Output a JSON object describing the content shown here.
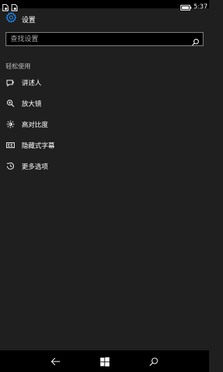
{
  "status_bar": {
    "time": "5:37",
    "left_icons": [
      "notification-doc-icon",
      "notification-doc-icon"
    ],
    "right_icons": [
      "battery-icon"
    ]
  },
  "header": {
    "icon": "gear-icon",
    "title": "设置"
  },
  "search": {
    "placeholder": "查找设置",
    "icon": "search-icon"
  },
  "section": {
    "title": "轻松使用"
  },
  "menu": {
    "items": [
      {
        "label": "讲述人",
        "icon": "narrator-icon"
      },
      {
        "label": "放大镜",
        "icon": "magnifier-icon"
      },
      {
        "label": "高对比度",
        "icon": "high-contrast-icon"
      },
      {
        "label": "隐藏式字幕",
        "icon": "closed-captions-icon"
      },
      {
        "label": "更多选项",
        "icon": "more-options-icon"
      }
    ]
  },
  "nav_bar": {
    "buttons": [
      "back-icon",
      "windows-start-icon",
      "search-icon"
    ]
  },
  "colors": {
    "background": "#1f1f1f",
    "accent": "#1e90ff",
    "text": "#ffffff",
    "secondary_text": "#bdbdbd",
    "bar": "#000000"
  }
}
